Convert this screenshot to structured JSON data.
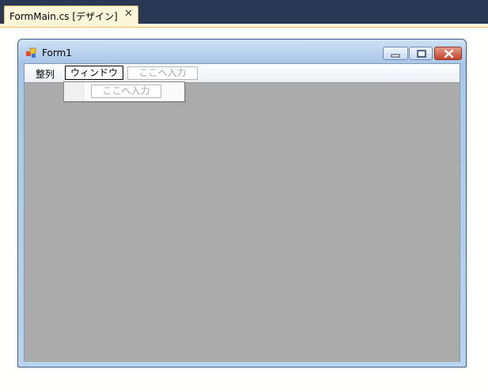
{
  "doc_tab": {
    "title": "FormMain.cs [デザイン]",
    "close_icon": "close-icon"
  },
  "form": {
    "title": "Form1",
    "icon": "form-app-icon",
    "caption_buttons": [
      "minimize-icon",
      "maximize-icon",
      "close-icon"
    ]
  },
  "menu": {
    "items": [
      {
        "label": "整列"
      },
      {
        "label": "ウィンドウ",
        "selected": true
      }
    ],
    "type_here": "ここへ入力"
  },
  "dropdown": {
    "parent": "ウィンドウ",
    "type_here": "ここへ入力"
  },
  "colors": {
    "ide_background": "#293955",
    "tab_background": "#fff5d9",
    "mdi_background": "#ababab"
  }
}
